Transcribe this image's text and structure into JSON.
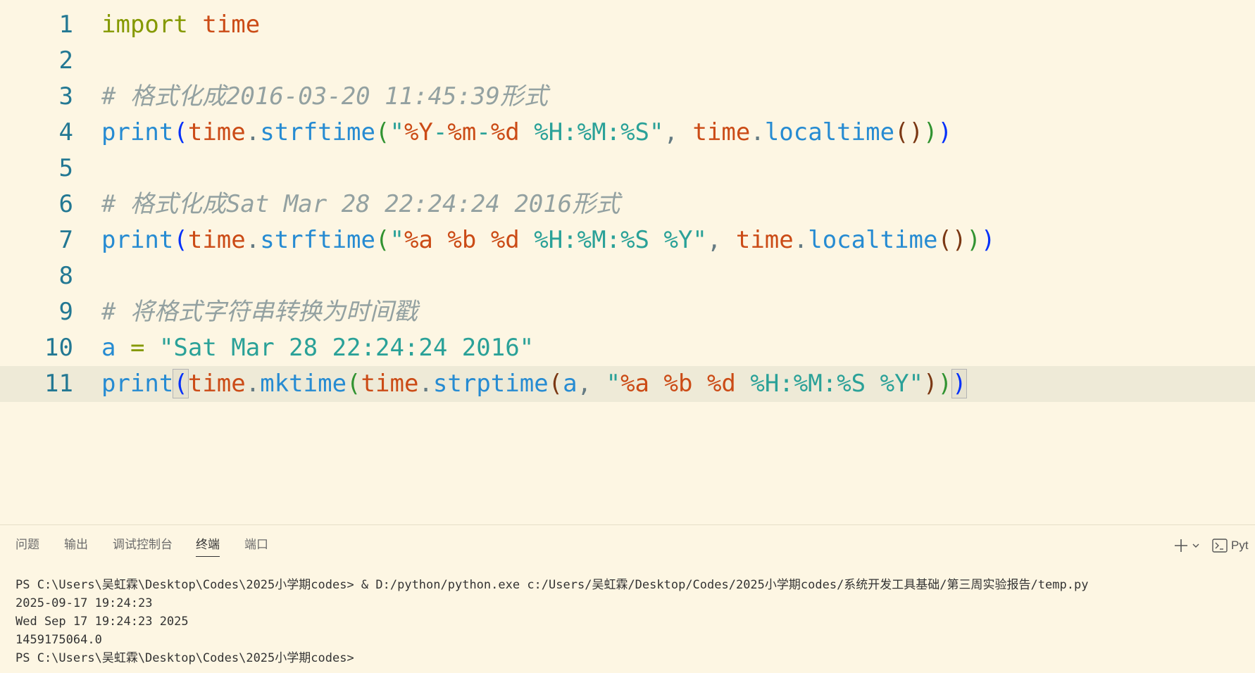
{
  "editor": {
    "theme_colors": {
      "background": "#fdf6e3",
      "current_line": "#eeead7",
      "line_number": "#237893",
      "keyword": "#859900",
      "module": "#cb4b16",
      "function": "#268bd2",
      "string": "#2aa198",
      "comment": "#93a1a1",
      "bracket_1": "#0431fa",
      "bracket_2": "#319331",
      "bracket_3": "#7b3814"
    },
    "current_line_number": 11,
    "lines": [
      {
        "number": "1",
        "tokens": [
          {
            "text": "import",
            "kind": "keyword",
            "color": "#859900"
          },
          {
            "text": " ",
            "kind": "space",
            "color": "#657b83"
          },
          {
            "text": "time",
            "kind": "module",
            "color": "#cb4b16"
          }
        ]
      },
      {
        "number": "2",
        "tokens": []
      },
      {
        "number": "3",
        "tokens": [
          {
            "text": "# 格式化成2016-03-20 11:45:39形式",
            "kind": "comment",
            "color": "#93a1a1"
          }
        ]
      },
      {
        "number": "4",
        "tokens": [
          {
            "text": "print",
            "kind": "function",
            "color": "#268bd2"
          },
          {
            "text": "(",
            "kind": "bracket",
            "color": "#0431fa"
          },
          {
            "text": "time",
            "kind": "module",
            "color": "#cb4b16"
          },
          {
            "text": ".",
            "kind": "punct",
            "color": "#657b83"
          },
          {
            "text": "strftime",
            "kind": "function",
            "color": "#268bd2"
          },
          {
            "text": "(",
            "kind": "bracket",
            "color": "#319331"
          },
          {
            "text": "\"",
            "kind": "string",
            "color": "#2aa198"
          },
          {
            "text": "%Y",
            "kind": "format",
            "color": "#cb4b16"
          },
          {
            "text": "-",
            "kind": "string",
            "color": "#2aa198"
          },
          {
            "text": "%m",
            "kind": "format",
            "color": "#cb4b16"
          },
          {
            "text": "-",
            "kind": "string",
            "color": "#2aa198"
          },
          {
            "text": "%d",
            "kind": "format",
            "color": "#cb4b16"
          },
          {
            "text": " %H:%M:%S\"",
            "kind": "string",
            "color": "#2aa198"
          },
          {
            "text": ", ",
            "kind": "punct",
            "color": "#657b83"
          },
          {
            "text": "time",
            "kind": "module",
            "color": "#cb4b16"
          },
          {
            "text": ".",
            "kind": "punct",
            "color": "#657b83"
          },
          {
            "text": "localtime",
            "kind": "function",
            "color": "#268bd2"
          },
          {
            "text": "()",
            "kind": "bracket",
            "color": "#7b3814"
          },
          {
            "text": ")",
            "kind": "bracket",
            "color": "#319331"
          },
          {
            "text": ")",
            "kind": "bracket",
            "color": "#0431fa"
          }
        ]
      },
      {
        "number": "5",
        "tokens": []
      },
      {
        "number": "6",
        "tokens": [
          {
            "text": "# 格式化成Sat Mar 28 22:24:24 2016形式",
            "kind": "comment",
            "color": "#93a1a1"
          }
        ]
      },
      {
        "number": "7",
        "tokens": [
          {
            "text": "print",
            "kind": "function",
            "color": "#268bd2"
          },
          {
            "text": "(",
            "kind": "bracket",
            "color": "#0431fa"
          },
          {
            "text": "time",
            "kind": "module",
            "color": "#cb4b16"
          },
          {
            "text": ".",
            "kind": "punct",
            "color": "#657b83"
          },
          {
            "text": "strftime",
            "kind": "function",
            "color": "#268bd2"
          },
          {
            "text": "(",
            "kind": "bracket",
            "color": "#319331"
          },
          {
            "text": "\"",
            "kind": "string",
            "color": "#2aa198"
          },
          {
            "text": "%a",
            "kind": "format",
            "color": "#cb4b16"
          },
          {
            "text": " ",
            "kind": "string",
            "color": "#2aa198"
          },
          {
            "text": "%b",
            "kind": "format",
            "color": "#cb4b16"
          },
          {
            "text": " ",
            "kind": "string",
            "color": "#2aa198"
          },
          {
            "text": "%d",
            "kind": "format",
            "color": "#cb4b16"
          },
          {
            "text": " %H:%M:%S %Y\"",
            "kind": "string",
            "color": "#2aa198"
          },
          {
            "text": ", ",
            "kind": "punct",
            "color": "#657b83"
          },
          {
            "text": "time",
            "kind": "module",
            "color": "#cb4b16"
          },
          {
            "text": ".",
            "kind": "punct",
            "color": "#657b83"
          },
          {
            "text": "localtime",
            "kind": "function",
            "color": "#268bd2"
          },
          {
            "text": "()",
            "kind": "bracket",
            "color": "#7b3814"
          },
          {
            "text": ")",
            "kind": "bracket",
            "color": "#319331"
          },
          {
            "text": ")",
            "kind": "bracket",
            "color": "#0431fa"
          }
        ]
      },
      {
        "number": "8",
        "tokens": []
      },
      {
        "number": "9",
        "tokens": [
          {
            "text": "# 将格式字符串转换为时间戳",
            "kind": "comment",
            "color": "#93a1a1"
          }
        ]
      },
      {
        "number": "10",
        "tokens": [
          {
            "text": "a",
            "kind": "variable",
            "color": "#268bd2"
          },
          {
            "text": " ",
            "kind": "space",
            "color": "#657b83"
          },
          {
            "text": "=",
            "kind": "operator",
            "color": "#859900"
          },
          {
            "text": " ",
            "kind": "space",
            "color": "#657b83"
          },
          {
            "text": "\"Sat Mar 28 22:24:24 2016\"",
            "kind": "string",
            "color": "#2aa198"
          }
        ]
      },
      {
        "number": "11",
        "tokens": [
          {
            "text": "print",
            "kind": "function",
            "color": "#268bd2"
          },
          {
            "text": "(",
            "kind": "bracket-match",
            "color": "#0431fa"
          },
          {
            "text": "time",
            "kind": "module",
            "color": "#cb4b16"
          },
          {
            "text": ".",
            "kind": "punct",
            "color": "#657b83"
          },
          {
            "text": "mktime",
            "kind": "function",
            "color": "#268bd2"
          },
          {
            "text": "(",
            "kind": "bracket",
            "color": "#319331"
          },
          {
            "text": "time",
            "kind": "module",
            "color": "#cb4b16"
          },
          {
            "text": ".",
            "kind": "punct",
            "color": "#657b83"
          },
          {
            "text": "strptime",
            "kind": "function",
            "color": "#268bd2"
          },
          {
            "text": "(",
            "kind": "bracket",
            "color": "#7b3814"
          },
          {
            "text": "a",
            "kind": "variable",
            "color": "#268bd2"
          },
          {
            "text": ", ",
            "kind": "punct",
            "color": "#657b83"
          },
          {
            "text": "\"",
            "kind": "string",
            "color": "#2aa198"
          },
          {
            "text": "%a",
            "kind": "format",
            "color": "#cb4b16"
          },
          {
            "text": " ",
            "kind": "string",
            "color": "#2aa198"
          },
          {
            "text": "%b",
            "kind": "format",
            "color": "#cb4b16"
          },
          {
            "text": " ",
            "kind": "string",
            "color": "#2aa198"
          },
          {
            "text": "%d",
            "kind": "format",
            "color": "#cb4b16"
          },
          {
            "text": " %H:%M:%S %Y\"",
            "kind": "string",
            "color": "#2aa198"
          },
          {
            "text": ")",
            "kind": "bracket",
            "color": "#7b3814"
          },
          {
            "text": ")",
            "kind": "bracket",
            "color": "#319331"
          },
          {
            "text": ")",
            "kind": "bracket-match",
            "color": "#0431fa"
          }
        ]
      }
    ]
  },
  "panel": {
    "tabs": [
      {
        "label": "问题",
        "name": "tab-problems",
        "active": false
      },
      {
        "label": "输出",
        "name": "tab-output",
        "active": false
      },
      {
        "label": "调试控制台",
        "name": "tab-debug-console",
        "active": false
      },
      {
        "label": "终端",
        "name": "tab-terminal",
        "active": true
      },
      {
        "label": "端口",
        "name": "tab-ports",
        "active": false
      }
    ],
    "actions": {
      "new_terminal_icon": "plus-icon",
      "dropdown_icon": "chevron-down-icon",
      "terminal_icon": "terminal-icon",
      "terminal_label": "Pyt"
    }
  },
  "terminal": {
    "lines": [
      "PS C:\\Users\\吴虹霖\\Desktop\\Codes\\2025小学期codes> & D:/python/python.exe c:/Users/吴虹霖/Desktop/Codes/2025小学期codes/系统开发工具基础/第三周实验报告/temp.py",
      "2025-09-17 19:24:23",
      "Wed Sep 17 19:24:23 2025",
      "1459175064.0",
      "PS C:\\Users\\吴虹霖\\Desktop\\Codes\\2025小学期codes>"
    ]
  }
}
